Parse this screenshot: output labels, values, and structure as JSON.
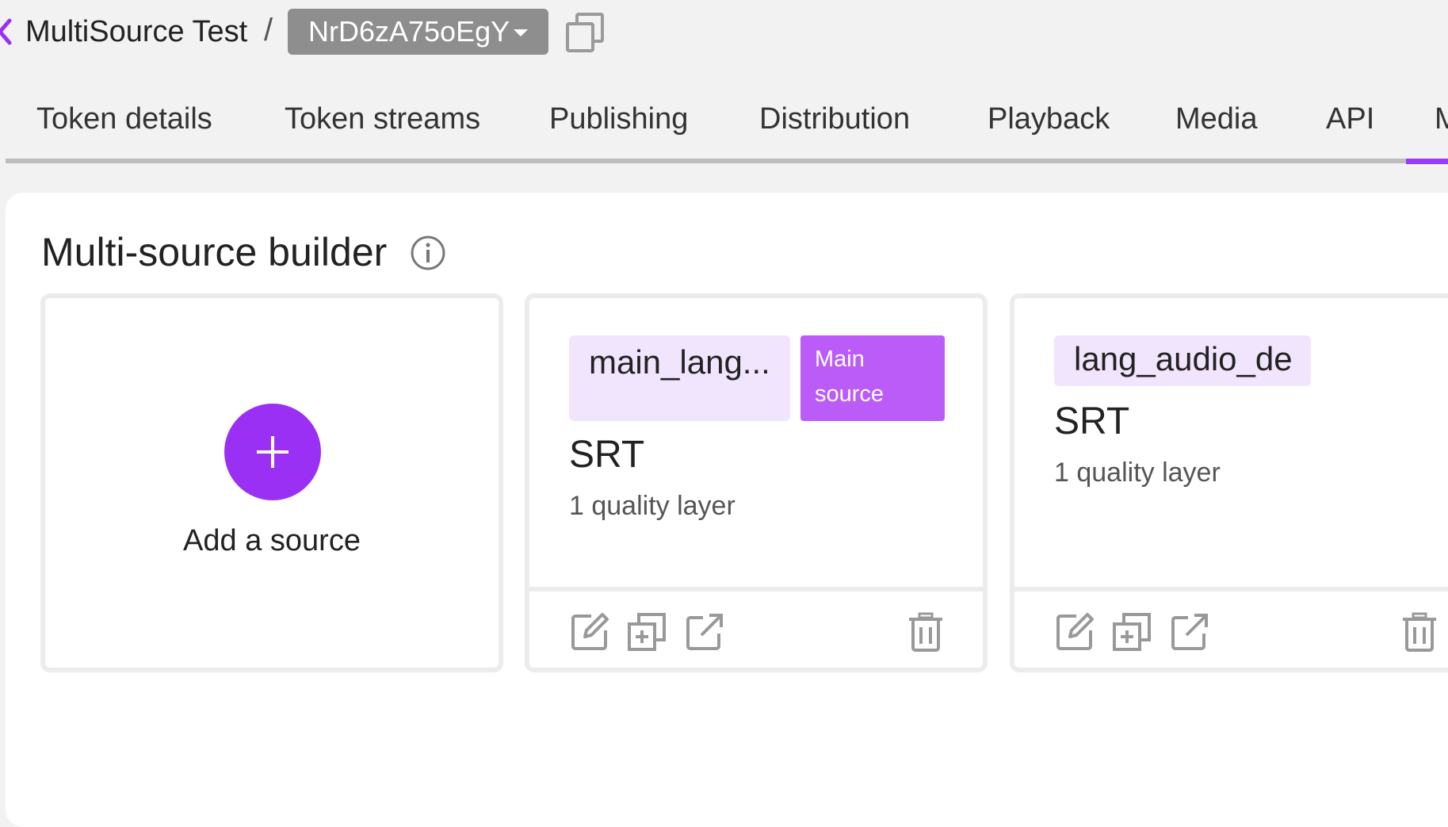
{
  "header": {
    "title": "MultiSource Test",
    "separator": "/",
    "token_id": "NrD6zA75oEgY"
  },
  "tabs": [
    {
      "label": "Token details"
    },
    {
      "label": "Token streams"
    },
    {
      "label": "Publishing"
    },
    {
      "label": "Distribution"
    },
    {
      "label": "Playback"
    },
    {
      "label": "Media"
    },
    {
      "label": "API"
    },
    {
      "label": "M",
      "active": true
    }
  ],
  "builder": {
    "title": "Multi-source builder",
    "add_label": "Add a source",
    "sources": [
      {
        "name": "main_lang...",
        "badge": "Main source",
        "protocol": "SRT",
        "layers": "1 quality layer"
      },
      {
        "name": "lang_audio_de",
        "protocol": "SRT",
        "layers": "1 quality layer"
      }
    ]
  },
  "colors": {
    "accent": "#9b30f5",
    "badge": "#bb5cf9",
    "name_chip": "#f1e4fd",
    "token_select": "#8e8e8e"
  },
  "icons": [
    "back-chevron-icon",
    "caret-down-icon",
    "copy-icon",
    "info-icon",
    "plus-icon",
    "edit-icon",
    "duplicate-icon",
    "open-external-icon",
    "trash-icon"
  ]
}
